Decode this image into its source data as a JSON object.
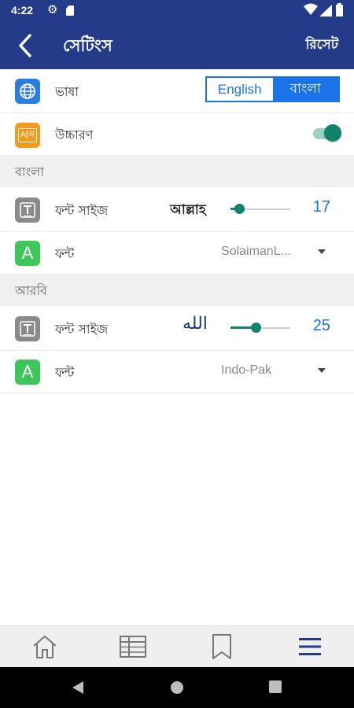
{
  "status_bar": {
    "time": "4:22",
    "icons": [
      "gear-icon",
      "sd-card-icon",
      "wifi-icon",
      "signal-icon",
      "battery-icon"
    ]
  },
  "app_bar": {
    "back_icon": "chevron-left-icon",
    "title": "সেটিংস",
    "reset_label": "রিসেট"
  },
  "settings": {
    "language": {
      "icon": "globe-icon",
      "label": "ভাষা",
      "options": [
        "English",
        "বাংলা"
      ],
      "selected": "বাংলা"
    },
    "pronunciation": {
      "icon": "pronunciation-icon",
      "icon_text": "A|অ",
      "label": "উচ্চারণ",
      "enabled": true
    }
  },
  "bangla_section": {
    "title": "বাংলা",
    "font_size": {
      "icon": "text-size-icon",
      "label": "ফন্ট সাইজ",
      "preview": "আল্লাহ",
      "value": "17",
      "slider_fraction": 0.14
    },
    "font": {
      "icon": "font-icon",
      "icon_text": "A",
      "label": "ফন্ট",
      "selected": "SolaimanL..."
    }
  },
  "arabic_section": {
    "title": "আরবি",
    "font_size": {
      "icon": "text-size-icon",
      "label": "ফন্ট সাইজ",
      "preview": "الله",
      "value": "25",
      "slider_fraction": 0.42
    },
    "font": {
      "icon": "font-icon",
      "icon_text": "A",
      "label": "ফন্ট",
      "selected": "Indo-Pak"
    }
  },
  "bottom_nav": {
    "items": [
      "home-icon",
      "table-icon",
      "bookmark-icon",
      "menu-icon"
    ],
    "active": "menu-icon"
  },
  "system_nav": [
    "back-triangle-icon",
    "home-circle-icon",
    "recents-square-icon"
  ],
  "colors": {
    "app_bar": "#243b8a",
    "accent_blue": "#1a73e8",
    "accent_green": "#11836a",
    "icon_blue": "#2a7de1",
    "icon_orange": "#f39a1d",
    "icon_gray": "#8a8a8a",
    "icon_green": "#3fc65a"
  }
}
